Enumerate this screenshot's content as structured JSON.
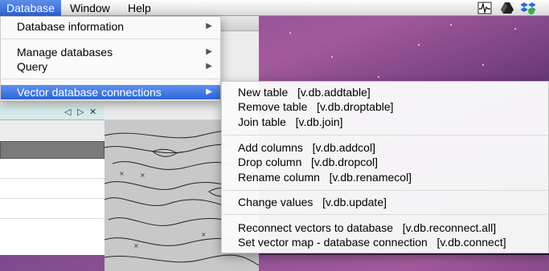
{
  "menubar": {
    "items": [
      {
        "label": "Database",
        "active": true
      },
      {
        "label": "Window",
        "active": false
      },
      {
        "label": "Help",
        "active": false
      }
    ],
    "tray_icons": [
      "activity-monitor-icon",
      "drive-icon",
      "dropbox-icon"
    ]
  },
  "main_menu": {
    "items": [
      {
        "label": "Database information",
        "submenu": true
      },
      {
        "label": "Manage databases",
        "submenu": true
      },
      {
        "label": "Query",
        "submenu": true
      },
      {
        "label": "Vector database connections",
        "submenu": true,
        "highlighted": true
      }
    ],
    "arrow_glyph": "▶"
  },
  "submenu": {
    "groups": [
      [
        {
          "label": "New table",
          "command": "[v.db.addtable]"
        },
        {
          "label": "Remove table",
          "command": "[v.db.droptable]"
        },
        {
          "label": "Join table",
          "command": "[v.db.join]"
        }
      ],
      [
        {
          "label": "Add columns",
          "command": "[v.db.addcol]"
        },
        {
          "label": "Drop column",
          "command": "[v.db.dropcol]"
        },
        {
          "label": "Rename column",
          "command": "[v.db.renamecol]"
        }
      ],
      [
        {
          "label": "Change values",
          "command": "[v.db.update]"
        }
      ],
      [
        {
          "label": "Reconnect vectors to database",
          "command": "[v.db.reconnect.all]"
        },
        {
          "label": "Set vector map - database connection",
          "command": "[v.db.connect]"
        }
      ]
    ]
  },
  "panel": {
    "controls": [
      "◁",
      "▷",
      "✕"
    ]
  },
  "colors": {
    "highlight": "#3a6fdd",
    "menubar": "#ececec",
    "desktop": "#8b4f93"
  }
}
